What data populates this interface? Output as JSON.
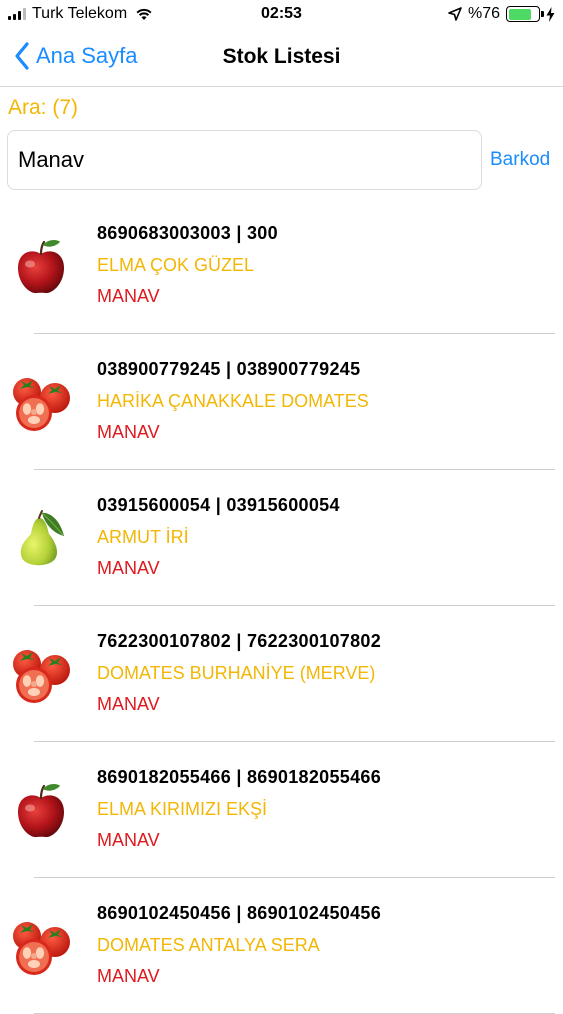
{
  "status_bar": {
    "carrier": "Turk Telekom",
    "time": "02:53",
    "battery_text": "%76",
    "battery_level": 0.76
  },
  "nav": {
    "back_label": "Ana Sayfa",
    "title": "Stok Listesi"
  },
  "search": {
    "count_label": "Ara: (7)",
    "value": "Manav",
    "barcode_label": "Barkod"
  },
  "items": [
    {
      "code": "8690683003003 | 300",
      "name": "ELMA ÇOK GÜZEL",
      "category": "MANAV",
      "icon": "apple-icon"
    },
    {
      "code": "038900779245 | 038900779245",
      "name": "HARİKA ÇANAKKALE DOMATES",
      "category": "MANAV",
      "icon": "tomato-icon"
    },
    {
      "code": "03915600054 | 03915600054",
      "name": "ARMUT İRİ",
      "category": "MANAV",
      "icon": "pear-icon"
    },
    {
      "code": "7622300107802 | 7622300107802",
      "name": "DOMATES BURHANİYE (MERVE)",
      "category": "MANAV",
      "icon": "tomato-icon"
    },
    {
      "code": "8690182055466 | 8690182055466",
      "name": "ELMA KIRIMIZI EKŞİ",
      "category": "MANAV",
      "icon": "apple-icon"
    },
    {
      "code": "8690102450456 | 8690102450456",
      "name": "DOMATES ANTALYA SERA",
      "category": "MANAV",
      "icon": "tomato-icon"
    }
  ]
}
